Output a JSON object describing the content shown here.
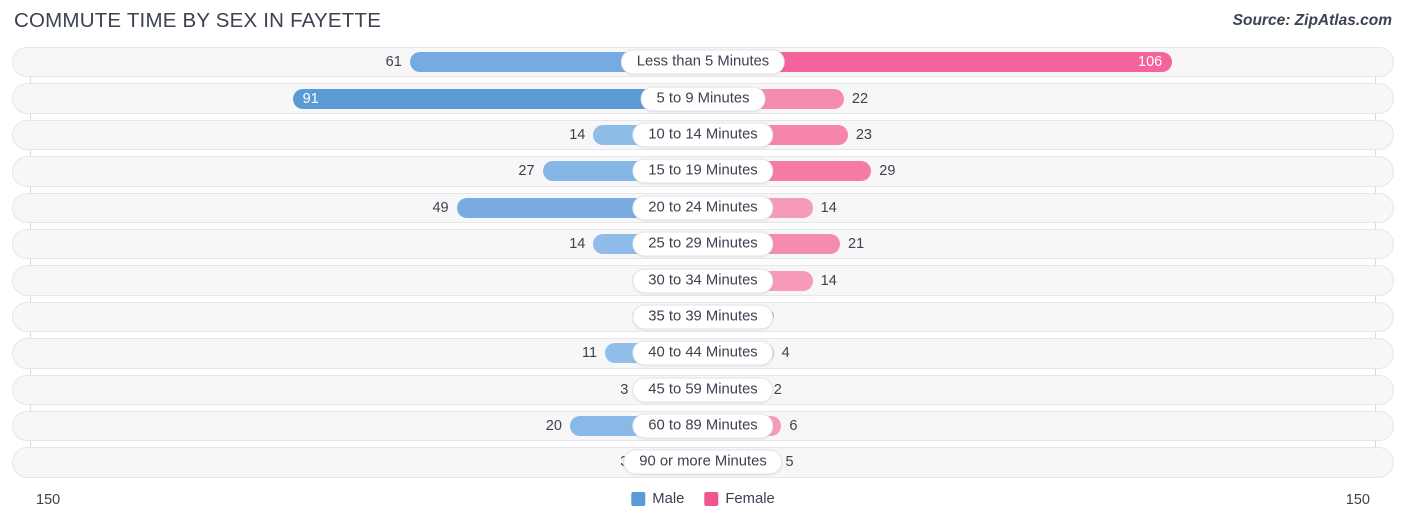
{
  "header": {
    "title": "COMMUTE TIME BY SEX IN FAYETTE",
    "source": "Source: ZipAtlas.com"
  },
  "footer": {
    "axis_left": "150",
    "axis_right": "150",
    "legend": [
      {
        "label": "Male",
        "color": "#5b9bd5"
      },
      {
        "label": "Female",
        "color": "#f0558f"
      }
    ]
  },
  "chart_data": {
    "type": "bar",
    "subtype": "diverging-bidirectional-bar",
    "title": "COMMUTE TIME BY SEX IN FAYETTE",
    "xlabel": "",
    "ylabel": "",
    "xlim": [
      150,
      150
    ],
    "axis_max": 150,
    "grid": false,
    "legend_position": "bottom-center",
    "categories": [
      "Less than 5 Minutes",
      "5 to 9 Minutes",
      "10 to 14 Minutes",
      "15 to 19 Minutes",
      "20 to 24 Minutes",
      "25 to 29 Minutes",
      "30 to 34 Minutes",
      "35 to 39 Minutes",
      "40 to 44 Minutes",
      "45 to 59 Minutes",
      "60 to 89 Minutes",
      "90 or more Minutes"
    ],
    "series": [
      {
        "name": "Male",
        "color": "#5b9bd5",
        "direction": "left",
        "values": [
          61,
          91,
          14,
          27,
          49,
          14,
          0,
          0,
          11,
          3,
          20,
          3
        ]
      },
      {
        "name": "Female",
        "color": "#f0558f",
        "direction": "right",
        "values": [
          106,
          22,
          23,
          29,
          14,
          21,
          14,
          0,
          4,
          2,
          6,
          5
        ]
      }
    ],
    "rows": [
      {
        "label": "Less than 5 Minutes",
        "male": "61",
        "female": "106",
        "male_value": 61,
        "female_value": 106,
        "male_inside": false,
        "female_inside": true,
        "male_color": "#76aae0",
        "female_color": "#f4639b"
      },
      {
        "label": "5 to 9 Minutes",
        "male": "91",
        "female": "22",
        "male_value": 91,
        "female_value": 22,
        "male_inside": true,
        "female_inside": false,
        "male_color": "#5b9bd5",
        "female_color": "#f58cb0"
      },
      {
        "label": "10 to 14 Minutes",
        "male": "14",
        "female": "23",
        "male_value": 14,
        "female_value": 23,
        "male_inside": false,
        "female_inside": false,
        "male_color": "#8fbce8",
        "female_color": "#f585ac"
      },
      {
        "label": "15 to 19 Minutes",
        "male": "27",
        "female": "29",
        "male_value": 27,
        "female_value": 29,
        "male_inside": false,
        "female_inside": false,
        "male_color": "#85b6e6",
        "female_color": "#f57ba5"
      },
      {
        "label": "20 to 24 Minutes",
        "male": "49",
        "female": "14",
        "male_value": 49,
        "female_value": 14,
        "male_inside": false,
        "female_inside": false,
        "male_color": "#79ace1",
        "female_color": "#f79ab8"
      },
      {
        "label": "25 to 29 Minutes",
        "male": "14",
        "female": "21",
        "male_value": 14,
        "female_value": 21,
        "male_inside": false,
        "female_inside": false,
        "male_color": "#8fbce8",
        "female_color": "#f58cb0"
      },
      {
        "label": "30 to 34 Minutes",
        "male": "0",
        "female": "14",
        "male_value": 0,
        "female_value": 14,
        "male_inside": false,
        "female_inside": false,
        "male_color": "#a3c8ed",
        "female_color": "#f79ab8"
      },
      {
        "label": "35 to 39 Minutes",
        "male": "0",
        "female": "0",
        "male_value": 0,
        "female_value": 0,
        "male_inside": false,
        "female_inside": false,
        "male_color": "#a3c8ed",
        "female_color": "#f79ab8"
      },
      {
        "label": "40 to 44 Minutes",
        "male": "11",
        "female": "4",
        "male_value": 11,
        "female_value": 4,
        "male_inside": false,
        "female_inside": false,
        "male_color": "#92beea",
        "female_color": "#f79ab8"
      },
      {
        "label": "45 to 59 Minutes",
        "male": "3",
        "female": "2",
        "male_value": 3,
        "female_value": 2,
        "male_inside": false,
        "female_inside": false,
        "male_color": "#9fc5ec",
        "female_color": "#f79ab8"
      },
      {
        "label": "60 to 89 Minutes",
        "male": "20",
        "female": "6",
        "male_value": 20,
        "female_value": 6,
        "male_inside": false,
        "female_inside": false,
        "male_color": "#89b9e7",
        "female_color": "#f79ab8"
      },
      {
        "label": "90 or more Minutes",
        "male": "3",
        "female": "5",
        "male_value": 3,
        "female_value": 5,
        "male_inside": false,
        "female_inside": false,
        "male_color": "#9fc5ec",
        "female_color": "#f79ab8"
      }
    ]
  }
}
